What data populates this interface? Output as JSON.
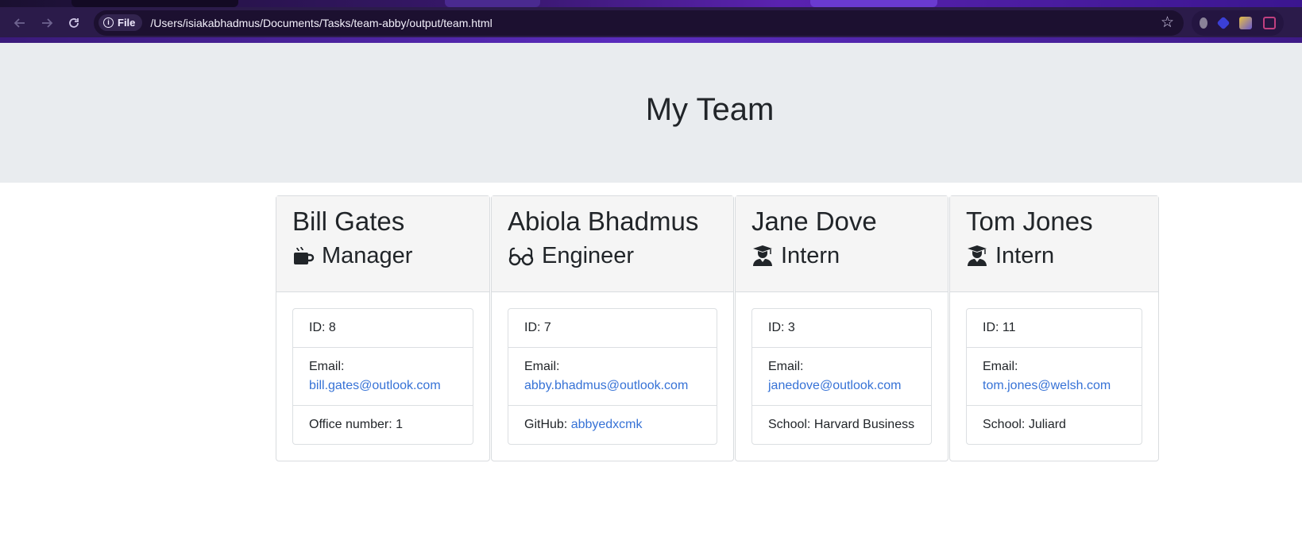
{
  "browser": {
    "file_chip_label": "File",
    "url": "/Users/isiakabhadmus/Documents/Tasks/team-abby/output/team.html"
  },
  "page": {
    "title": "My Team"
  },
  "team": [
    {
      "name": "Bill Gates",
      "role": "Manager",
      "role_icon": "mug-icon",
      "id": "ID: 8",
      "email_label": "Email:",
      "email": "bill.gates@outlook.com",
      "extra_prefix": "Office number: 1",
      "extra_link": ""
    },
    {
      "name": "Abiola Bhadmus",
      "role": "Engineer",
      "role_icon": "glasses-icon",
      "id": "ID: 7",
      "email_label": "Email:",
      "email": "abby.bhadmus@outlook.com",
      "extra_prefix": "GitHub: ",
      "extra_link": "abbyedxcmk"
    },
    {
      "name": "Jane Dove",
      "role": "Intern",
      "role_icon": "graduate-icon",
      "id": "ID: 3",
      "email_label": "Email:",
      "email": "janedove@outlook.com",
      "extra_prefix": "School: Harvard Business",
      "extra_link": ""
    },
    {
      "name": "Tom Jones",
      "role": "Intern",
      "role_icon": "graduate-icon",
      "id": "ID: 11",
      "email_label": "Email:",
      "email": "tom.jones@welsh.com",
      "extra_prefix": "School: Juliard",
      "extra_link": ""
    }
  ]
}
